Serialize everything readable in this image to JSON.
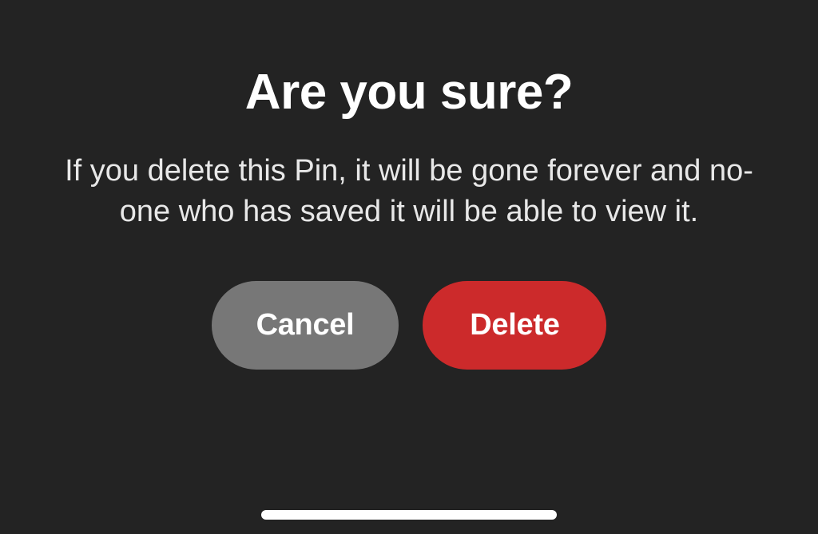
{
  "dialog": {
    "title": "Are you sure?",
    "message": "If you delete this Pin, it will be gone forever and no-one who has saved it will be able to view it.",
    "cancel_label": "Cancel",
    "delete_label": "Delete"
  },
  "colors": {
    "background": "#232323",
    "cancel_button": "#777777",
    "delete_button": "#cc2a2b",
    "text_primary": "#ffffff"
  }
}
